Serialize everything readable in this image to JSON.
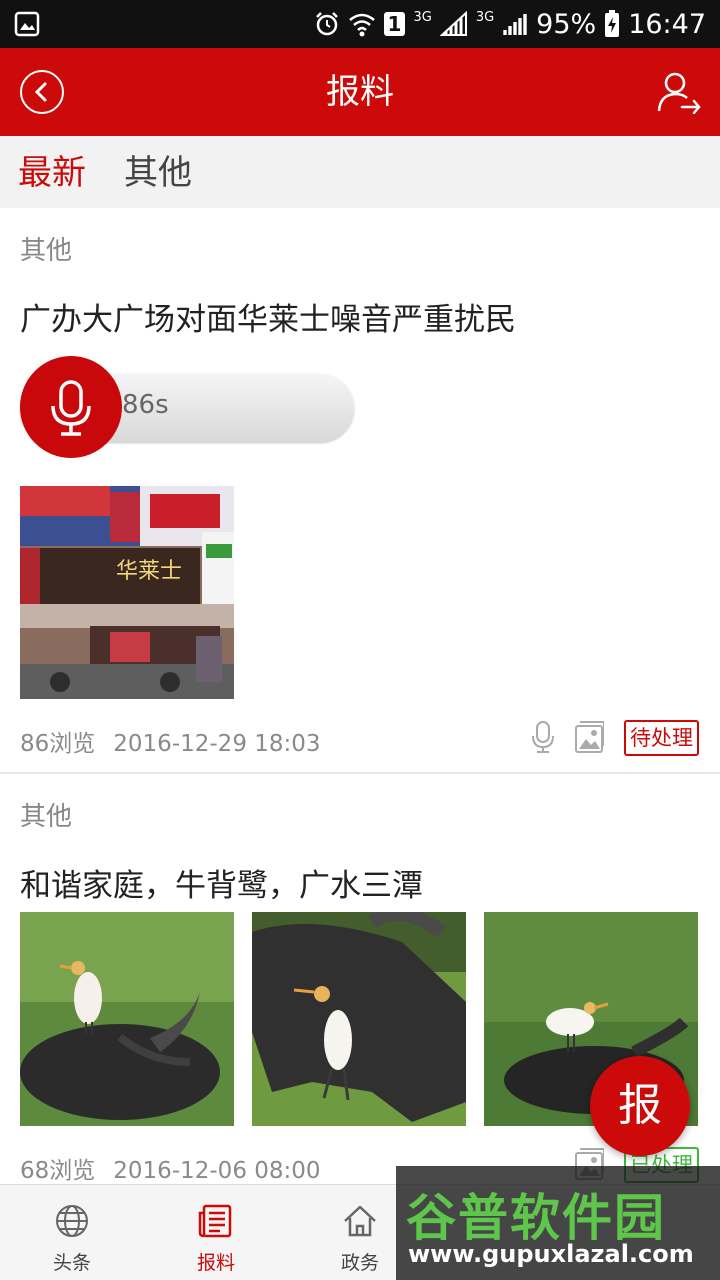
{
  "status_bar": {
    "battery": "95%",
    "time": "16:47",
    "network_1": "3G",
    "network_2": "3G",
    "sim": "1"
  },
  "header": {
    "title": "报料"
  },
  "tabs": [
    {
      "label": "最新",
      "active": true
    },
    {
      "label": "其他",
      "active": false
    }
  ],
  "posts": [
    {
      "category": "其他",
      "title": "广办大广场对面华莱士噪音严重扰民",
      "audio_duration": "86s",
      "views": "86浏览",
      "date": "2016-12-29 18:03",
      "status": "待处理",
      "status_color": "#cc0a0a",
      "photo_sign_text": "华莱士"
    },
    {
      "category": "其他",
      "title": "和谐家庭，牛背鹭，广水三潭",
      "views": "68浏览",
      "date": "2016-12-06 08:00",
      "status": "已处理",
      "status_color": "#3fb83a"
    }
  ],
  "fab": {
    "label": "报"
  },
  "bottom_nav": [
    {
      "label": "头条",
      "icon": "globe-icon",
      "active": false
    },
    {
      "label": "报料",
      "icon": "news-icon",
      "active": true
    },
    {
      "label": "政务",
      "icon": "home-icon",
      "active": false
    }
  ],
  "watermark": {
    "text": "谷普软件园",
    "url": "www.gupuxlazal.com"
  },
  "colors": {
    "brand_red": "#cc0a0a",
    "done_green": "#3fb83a"
  }
}
